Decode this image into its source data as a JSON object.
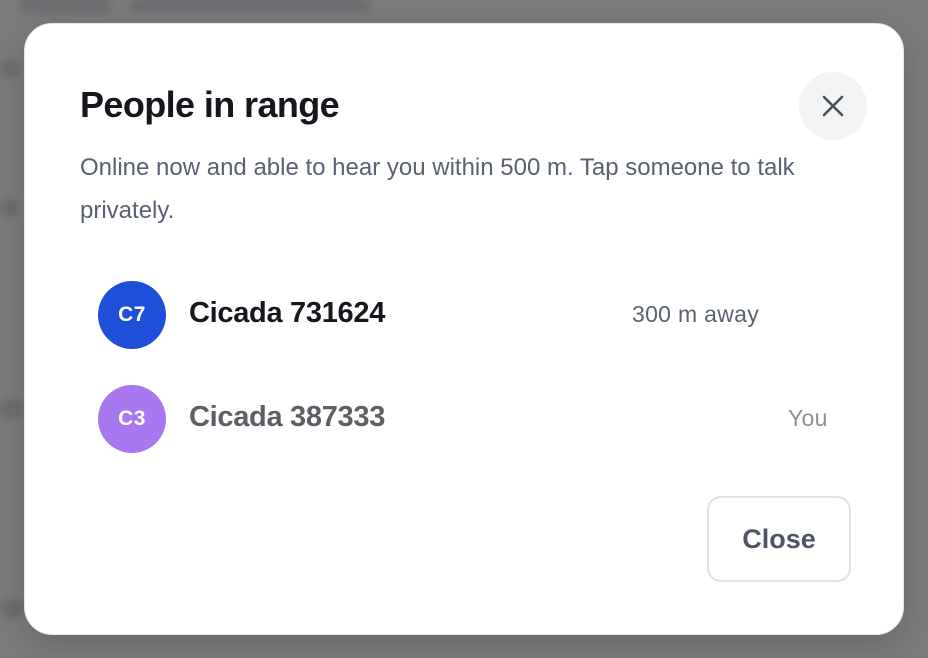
{
  "dialog": {
    "title": "People in range",
    "description": "Online now and able to hear you within 500 m. Tap someone to talk privately.",
    "close_icon": "close-icon",
    "people": [
      {
        "initials": "C7",
        "name": "Cicada 731624",
        "meta": "300 m away",
        "avatar_color": "#1e4fd8",
        "name_color": "#15171c",
        "meta_color": "#5a6270"
      },
      {
        "initials": "C3",
        "name": "Cicada 387333",
        "meta": "You",
        "avatar_color": "#a977f0",
        "name_color": "#5c5f66",
        "meta_color": "#8a9099"
      }
    ],
    "close_button_label": "Close"
  }
}
